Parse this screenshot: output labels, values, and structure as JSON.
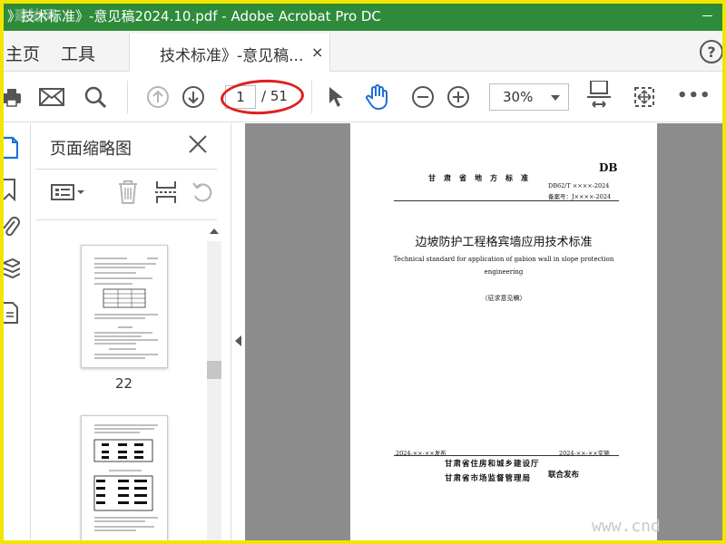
{
  "window": {
    "title": "》技术标准》-意见稿2024.10.pdf - Adobe Acrobat Pro DC",
    "brand_overlay": "建协网"
  },
  "nav": {
    "home_label": "主页",
    "tools_label": "工具"
  },
  "tab": {
    "label": "技术标准》-意见稿...",
    "close_glyph": "×"
  },
  "help": {
    "glyph": "?"
  },
  "toolbar": {
    "current_page": "1",
    "total_pages": "/ 51",
    "zoom": "30%",
    "more_glyph": "•••",
    "highlight_color": "#e02020"
  },
  "panel": {
    "title": "页面缩略图",
    "thumbnails": [
      {
        "page_number": "22"
      },
      {
        "page_number": ""
      }
    ]
  },
  "document": {
    "db_mark": "DB",
    "standard_type": "甘肃省地方标准",
    "code": "DB62/T ××××-2024",
    "record_no": "备案号：J××××-2024",
    "title_cn": "边坡防护工程格宾墙应用技术标准",
    "title_en_line1": "Technical standard for application of gabion wall in slope protection",
    "title_en_line2": "engineering",
    "draft_note": "（征求意见稿）",
    "publish_date": "2024-××-××发布",
    "implement_date": "2024-××-××实施",
    "org1": "甘肃省住房和城乡建设厅",
    "org2": "甘肃省市场监督管理局",
    "joint_label": "联合发布"
  },
  "watermark": "www.cnd",
  "colors": {
    "titlebar": "#2e8b3a",
    "frame": "#f2e600",
    "accent_blue": "#1e6fd9",
    "doc_bg": "#8c8c8c"
  }
}
